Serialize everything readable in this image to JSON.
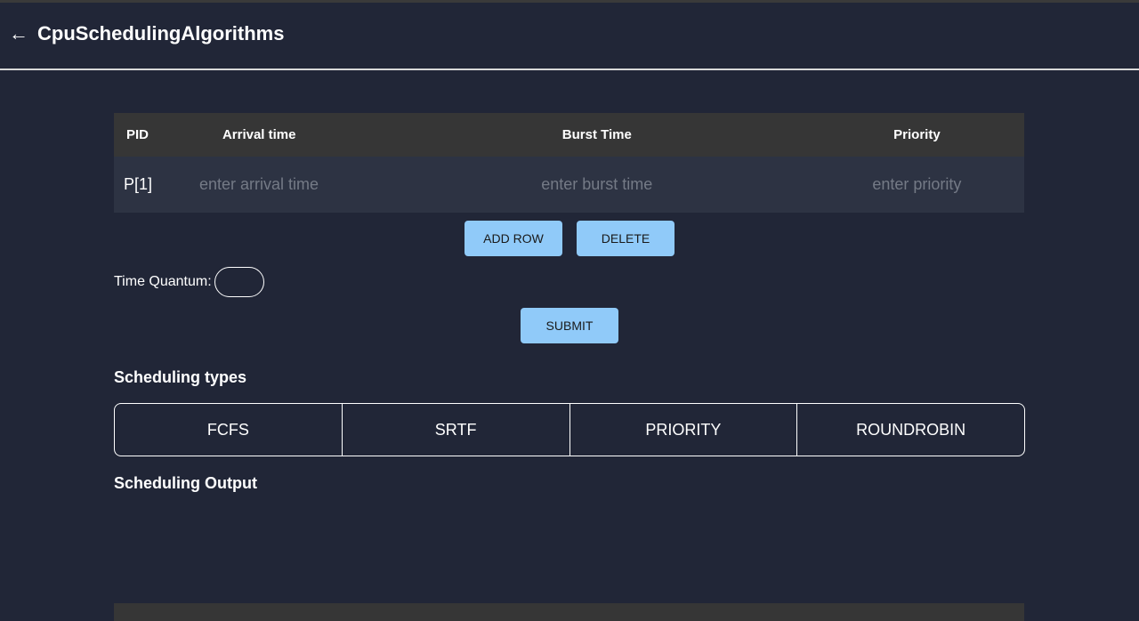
{
  "header": {
    "title": "CpuSchedulingAlgorithms",
    "back_icon": "←"
  },
  "table": {
    "columns": [
      "PID",
      "Arrival time",
      "Burst Time",
      "Priority"
    ],
    "rows": [
      {
        "pid": "P[1]",
        "arrival_placeholder": "enter arrival time",
        "burst_placeholder": "enter burst time",
        "priority_placeholder": "enter priority"
      }
    ]
  },
  "buttons": {
    "add_row": "ADD ROW",
    "delete": "DELETE",
    "submit": "SUBMIT"
  },
  "time_quantum": {
    "label": "Time Quantum:"
  },
  "scheduling_types": {
    "heading": "Scheduling types",
    "options": [
      "FCFS",
      "SRTF",
      "PRIORITY",
      "ROUNDROBIN"
    ]
  },
  "output": {
    "heading": "Scheduling Output"
  }
}
